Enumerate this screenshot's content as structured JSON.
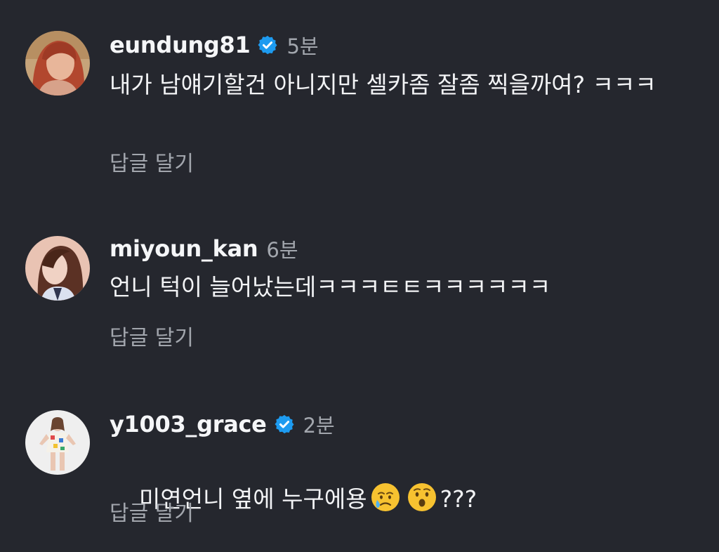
{
  "comments": [
    {
      "username": "eundung81",
      "verified": true,
      "time": "5분",
      "text": "내가 남얘기할건 아니지만 셀카좀 잘좀 찍을까여? ㅋㅋㅋ",
      "reply_label": "답글 달기",
      "avatar_icon": "profile-photo-red-hair"
    },
    {
      "username": "miyoun_kan",
      "verified": false,
      "time": "6분",
      "text": "언니 턱이 늘어났는데ㅋㅋㅋㅌㅌㅋㅋㅋㅋㅋㅋ",
      "reply_label": "답글 달기",
      "avatar_icon": "profile-photo-dark-hair"
    },
    {
      "username": "y1003_grace",
      "verified": true,
      "time": "2분",
      "text_before": "미연언니 옆에 누구에용",
      "emojis": [
        "crying-face-emoji",
        "surprised-face-emoji"
      ],
      "text_after": "???",
      "reply_label": "답글 달기",
      "avatar_icon": "profile-photo-full-body"
    }
  ],
  "colors": {
    "background": "#25272e",
    "text": "#f2f3f5",
    "muted": "#a2a6ad",
    "verified": "#1d9bf0"
  }
}
